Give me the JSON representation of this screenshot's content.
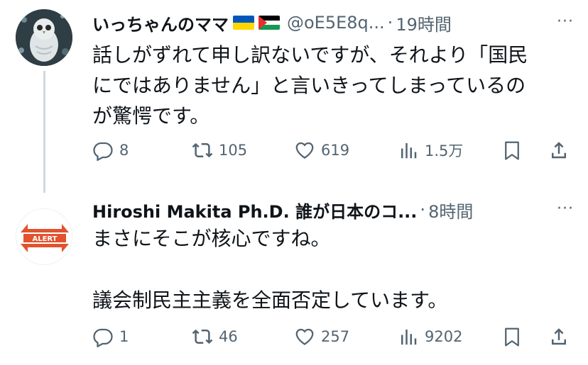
{
  "tweets": [
    {
      "author_name": "いっちゃんのママ",
      "flags": [
        "ukraine-flag",
        "palestine-flag"
      ],
      "handle": "@oE5E8q...",
      "time": "19時間",
      "text_lines": [
        "話しがずれて申し訳ないですが、それより「国民",
        "にではありません」と言いきってしまっているの",
        "が驚愕です。"
      ],
      "actions": {
        "replies": "8",
        "retweets": "105",
        "likes": "619",
        "views": "1.5万"
      }
    },
    {
      "author_name": "Hiroshi Makita Ph.D. 誰が日本のコ...",
      "handle": "",
      "time": "8時間",
      "avatar_text": "ALERT",
      "paragraphs": [
        "まさにそこが核心ですね。",
        "議会制民主主義を全面否定しています。"
      ],
      "actions": {
        "replies": "1",
        "retweets": "46",
        "likes": "257",
        "views": "9202"
      }
    }
  ],
  "ui": {
    "separator": "·",
    "more": "···"
  },
  "colors": {
    "text": "#0f1419",
    "secondary": "#536471",
    "line": "#cfd9de",
    "alert": "#e2522f"
  }
}
